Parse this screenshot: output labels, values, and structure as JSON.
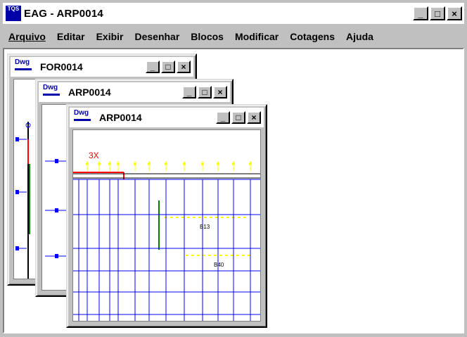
{
  "app": {
    "title": "EAG - ARP0014",
    "logo_text": "TQS",
    "controls": {
      "minimize": "_",
      "maximize": "□",
      "close": "×"
    }
  },
  "menu": [
    {
      "label": "Arquivo",
      "accel": "A"
    },
    {
      "label": "Editar",
      "accel": "E"
    },
    {
      "label": "Exibir",
      "accel": "x"
    },
    {
      "label": "Desenhar",
      "accel": "D"
    },
    {
      "label": "Blocos",
      "accel": "B"
    },
    {
      "label": "Modificar",
      "accel": "M"
    },
    {
      "label": "Cotagens",
      "accel": "C"
    },
    {
      "label": "Ajuda",
      "accel": "j"
    }
  ],
  "windows": [
    {
      "title": "FOR0014",
      "icon_text": "Dwg"
    },
    {
      "title": "ARP0014",
      "icon_text": "Dwg"
    },
    {
      "title": "ARP0014",
      "icon_text": "Dwg"
    }
  ],
  "drawing": {
    "label_3x": "3X",
    "tag_b13": "B13",
    "tag_b40": "B40"
  },
  "colors": {
    "grid": "#0000ff",
    "highlight": "#ff0000",
    "marker": "#ffff00",
    "rebar": "#008000"
  }
}
